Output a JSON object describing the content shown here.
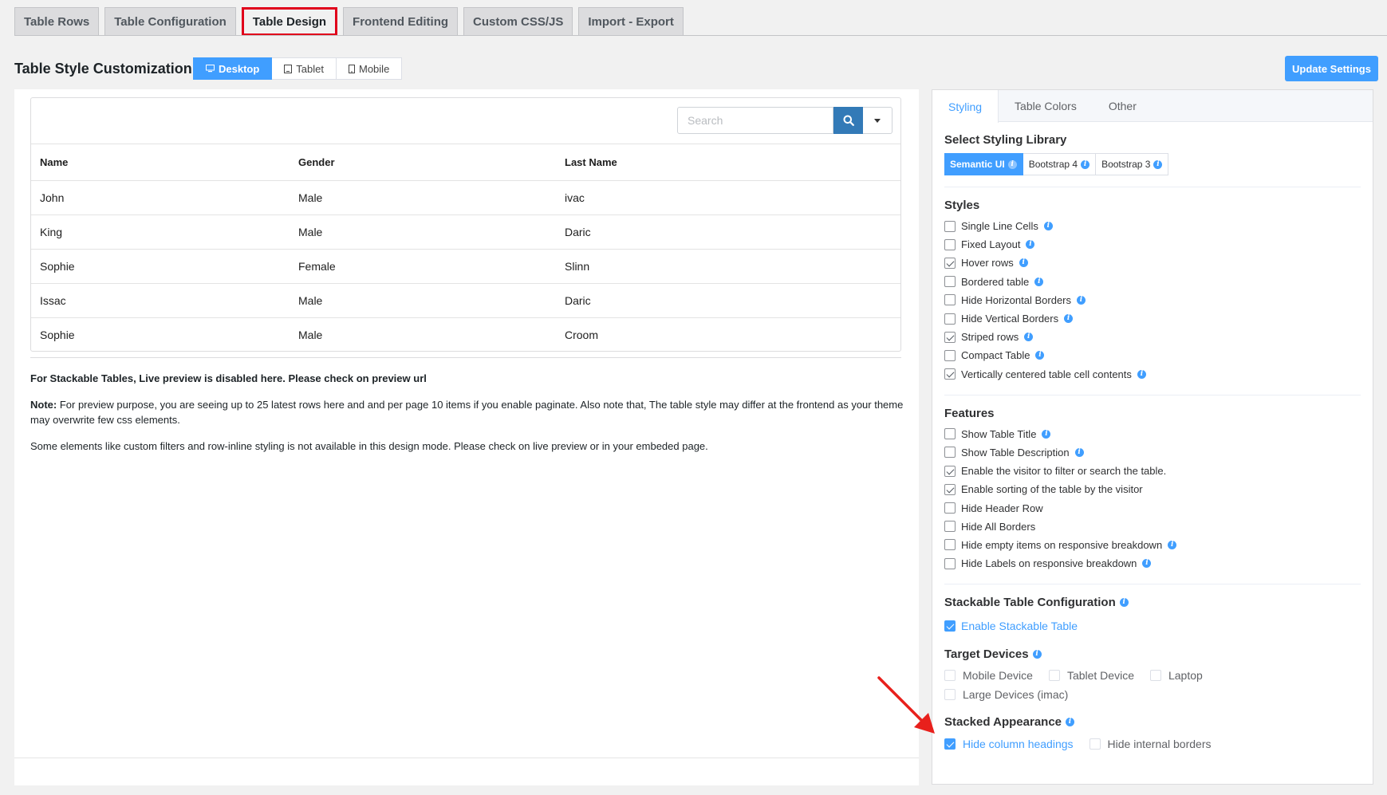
{
  "top_tabs": [
    "Table Rows",
    "Table Configuration",
    "Table Design",
    "Frontend Editing",
    "Custom CSS/JS",
    "Import - Export"
  ],
  "active_tab": "Table Design",
  "page_title": "Table Style Customization",
  "devices": [
    "Desktop",
    "Tablet",
    "Mobile"
  ],
  "update_label": "Update Settings",
  "search": {
    "placeholder": "Search"
  },
  "table": {
    "headers": [
      "Name",
      "Gender",
      "Last Name"
    ],
    "rows": [
      [
        "John",
        "Male",
        "ivac"
      ],
      [
        "King",
        "Male",
        "Daric"
      ],
      [
        "Sophie",
        "Female",
        "Slinn"
      ],
      [
        "Issac",
        "Male",
        "Daric"
      ],
      [
        "Sophie",
        "Male",
        "Croom"
      ]
    ]
  },
  "notes": {
    "stackable": "For Stackable Tables, Live preview is disabled here. Please check on preview url",
    "note_label": "Note:",
    "note_text": "For preview purpose, you are seeing up to 25 latest rows here and and per page 10 items if you enable paginate. Also note that, The table style may differ at the frontend as your theme may overwrite few css elements.",
    "elements": "Some elements like custom filters and row-inline styling is not available in this design mode. Please check on live preview or in your embeded page."
  },
  "right_tabs": [
    "Styling",
    "Table Colors",
    "Other"
  ],
  "styling_library": {
    "title": "Select Styling Library",
    "options": [
      "Semantic UI",
      "Bootstrap 4",
      "Bootstrap 3"
    ]
  },
  "styles": {
    "title": "Styles",
    "items": [
      {
        "label": "Single Line Cells",
        "checked": false
      },
      {
        "label": "Fixed Layout",
        "checked": false
      },
      {
        "label": "Hover rows",
        "checked": true
      },
      {
        "label": "Bordered table",
        "checked": false
      },
      {
        "label": "Hide Horizontal Borders",
        "checked": false
      },
      {
        "label": "Hide Vertical Borders",
        "checked": false
      },
      {
        "label": "Striped rows",
        "checked": true
      },
      {
        "label": "Compact Table",
        "checked": false
      },
      {
        "label": "Vertically centered table cell contents",
        "checked": true
      }
    ]
  },
  "features": {
    "title": "Features",
    "items": [
      {
        "label": "Show Table Title",
        "checked": false
      },
      {
        "label": "Show Table Description",
        "checked": false
      },
      {
        "label": "Enable the visitor to filter or search the table.",
        "checked": true
      },
      {
        "label": "Enable sorting of the table by the visitor",
        "checked": true
      },
      {
        "label": "Hide Header Row",
        "checked": false
      },
      {
        "label": "Hide All Borders",
        "checked": false
      },
      {
        "label": "Hide empty items on responsive breakdown",
        "checked": false
      },
      {
        "label": "Hide Labels on responsive breakdown",
        "checked": false
      }
    ]
  },
  "stackable": {
    "title": "Stackable Table Configuration",
    "enable_label": "Enable Stackable Table",
    "target_title": "Target Devices",
    "targets": [
      "Mobile Device",
      "Tablet Device",
      "Laptop",
      "Large Devices (imac)"
    ],
    "appearance_title": "Stacked Appearance",
    "hide_headings": "Hide column headings",
    "hide_borders": "Hide internal borders"
  },
  "colors": {
    "accent": "#409eff",
    "highlight": "#e0001b"
  }
}
